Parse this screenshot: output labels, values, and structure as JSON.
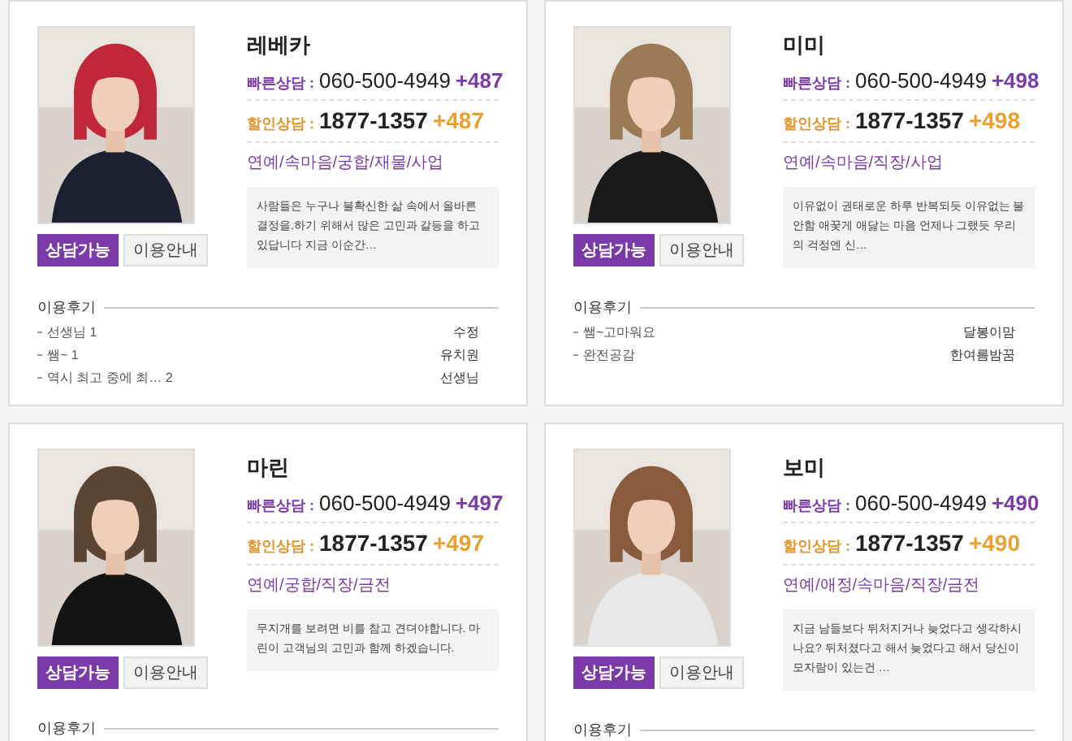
{
  "counselors": [
    {
      "name": "레베카",
      "fast_label": "빠른상담 :",
      "fast_phone": "060-500-4949",
      "fast_code": "+487",
      "discount_label": "할인상담 :",
      "discount_phone": "1877-1357",
      "discount_code": "+487",
      "topics": "연예/속마음/궁합/재물/사업",
      "intro": "사람들은 누구나 불확신한 삶 속에서 올바른 결정을.하기 위해서 많은 고민과 갈등을 하고 있답니다 지금 이순간…",
      "status_button": "상담가능",
      "guide_button": "이용안내",
      "reviews_title": "이용후기",
      "reviews": [
        {
          "text": "선생님  1",
          "author": "수정"
        },
        {
          "text": "쌤~  1",
          "author": "유치원"
        },
        {
          "text": "역시 최고 중에 최…  2",
          "author": "선생님"
        }
      ]
    },
    {
      "name": "미미",
      "fast_label": "빠른상담 :",
      "fast_phone": "060-500-4949",
      "fast_code": "+498",
      "discount_label": "할인상담 :",
      "discount_phone": "1877-1357",
      "discount_code": "+498",
      "topics": "연예/속마음/직장/사업",
      "intro": "이유없이 권태로운 하루 반복되듯 이유없는 불안함 애꿎게 애닳는 마음 언제나 그랬듯 우리의 걱정엔 신…",
      "status_button": "상담가능",
      "guide_button": "이용안내",
      "reviews_title": "이용후기",
      "reviews": [
        {
          "text": "쌤~고마워요",
          "author": "달봉이맘"
        },
        {
          "text": "완전공감",
          "author": "한여름밤꿈"
        }
      ]
    },
    {
      "name": "마린",
      "fast_label": "빠른상담 :",
      "fast_phone": "060-500-4949",
      "fast_code": "+497",
      "discount_label": "할인상담 :",
      "discount_phone": "1877-1357",
      "discount_code": "+497",
      "topics": "연예/궁합/직장/금전",
      "intro": "무지개를 보려면 비를 참고 견뎌야합니다. 마린이 고객님의 고민과 함께 하겠습니다.",
      "status_button": "상담가능",
      "guide_button": "이용안내",
      "reviews_title": "이용후기"
    },
    {
      "name": "보미",
      "fast_label": "빠른상담 :",
      "fast_phone": "060-500-4949",
      "fast_code": "+490",
      "discount_label": "할인상담 :",
      "discount_phone": "1877-1357",
      "discount_code": "+490",
      "topics": "연예/애정/속마음/직장/금전",
      "intro": "지금 남들보다 뒤처지거나 늦었다고 생각하시나요? 뒤처졌다고 해서 늦었다고 해서 당신이 모자람이 있는건 …",
      "status_button": "상담가능",
      "guide_button": "이용안내",
      "reviews_title": "이용후기"
    }
  ]
}
